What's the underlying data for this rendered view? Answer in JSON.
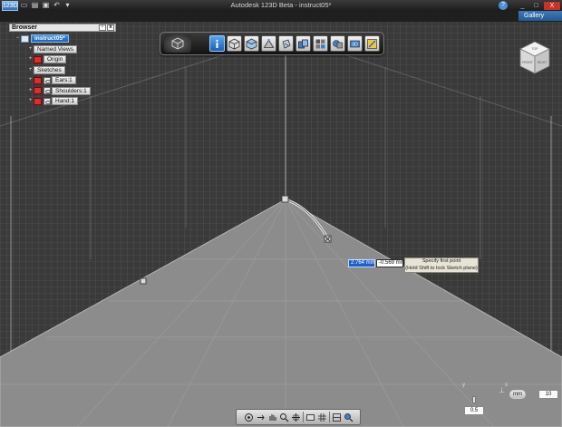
{
  "window": {
    "app_title": "Autodesk 123D Beta - instruct05*",
    "app_logo": "123D",
    "gallery_tab": "Gallery",
    "help_icon": "?",
    "minimize": "_",
    "maximize": "□",
    "close": "X"
  },
  "quick_access": {
    "new": "▭",
    "open": "▤",
    "save": "▣",
    "undo": "↶",
    "redo_dropdown": "▾"
  },
  "browser": {
    "title": "Browser",
    "pin": "▫",
    "close": "x",
    "items": [
      {
        "label": "instruct05*",
        "selected": true
      },
      {
        "label": "Named Views"
      },
      {
        "label": "Origin"
      },
      {
        "label": "Sketches"
      },
      {
        "label": "Ears:1"
      },
      {
        "label": "Shoulders:1"
      },
      {
        "label": "Hand:1"
      }
    ]
  },
  "toolbar": {
    "tools": [
      "info-icon",
      "primitives-icon",
      "sketch-icon",
      "construct-icon",
      "modify-icon",
      "pattern-icon",
      "grouping-icon",
      "combine-icon",
      "measure-icon",
      "material-icon"
    ]
  },
  "viewcube": {
    "top": "TOP",
    "front": "FRONT",
    "right": "RIGHT"
  },
  "dimension": {
    "x_value": "2.764 mm",
    "y_value": "-0.569 mm"
  },
  "tooltip": {
    "line1": "Specify first point",
    "line2": "(Hold Shift to lock Sketch plane)"
  },
  "snap": {
    "unit": "mm",
    "grid_value": "10",
    "snap_value": "0.5",
    "axis_y": "y",
    "axis_x": "x"
  }
}
